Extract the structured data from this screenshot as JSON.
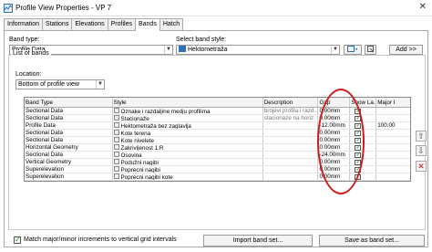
{
  "window": {
    "title": "Profile View Properties - VP 7"
  },
  "tabs": [
    "Information",
    "Stations",
    "Elevations",
    "Profiles",
    "Bands",
    "Hatch"
  ],
  "active_tab": "Bands",
  "band_type": {
    "label": "Band type:",
    "value": "Profile Data"
  },
  "band_style": {
    "label": "Select band style:",
    "value": "Hektometraža"
  },
  "buttons": {
    "add": "Add >>",
    "import": "Import band set...",
    "save": "Save as band set..."
  },
  "list_of_bands": {
    "title": "List of bands",
    "location_label": "Location:",
    "location_value": "Bottom of profile view",
    "columns": [
      "Band Type",
      "Style",
      "Description",
      "Gap",
      "Show La...",
      "Major I"
    ],
    "rows": [
      {
        "type": "Sectional Data",
        "style": "Oznake i razdaljine medju profilima",
        "desc": "brojevi profila i razd...",
        "gap": "0.00mm",
        "show": true,
        "major": ""
      },
      {
        "type": "Sectional Data",
        "style": "Stacionaže",
        "desc": "stacionaze na horiz",
        "gap": "0.00mm",
        "show": true,
        "major": ""
      },
      {
        "type": "Profile Data",
        "style": "Hektometraža bez zaglavlja",
        "desc": "",
        "gap": "-12.00mm",
        "show": true,
        "major": "100.00"
      },
      {
        "type": "Sectional Data",
        "style": "Kote terena",
        "desc": "",
        "gap": "0.00mm",
        "show": true,
        "major": ""
      },
      {
        "type": "Sectional Data",
        "style": "Kote nivelete",
        "desc": "",
        "gap": "0.00mm",
        "show": true,
        "major": ""
      },
      {
        "type": "Horizontal Geometry",
        "style": "Zakrivljenost 1:R",
        "desc": "",
        "gap": "0.00mm",
        "show": true,
        "major": ""
      },
      {
        "type": "Sectional Data",
        "style": "Osovina",
        "desc": "",
        "gap": "-24.00mm",
        "show": true,
        "major": ""
      },
      {
        "type": "Vertical Geometry",
        "style": "Podužni nagibi",
        "desc": "",
        "gap": "0.00mm",
        "show": true,
        "major": ""
      },
      {
        "type": "Superelevation",
        "style": "Poprecni nagibi",
        "desc": "",
        "gap": "0.00mm",
        "show": true,
        "major": ""
      },
      {
        "type": "Superelevation",
        "style": "Poprecni nagibi kote",
        "desc": "",
        "gap": "0.00mm",
        "show": true,
        "major": ""
      }
    ]
  },
  "match_checkbox": {
    "label": "Match major/minor increments to vertical grid intervals",
    "checked": true
  },
  "colors": {
    "annotation_ellipse": "#cc1c1c",
    "style_swatch": "#2f6fb5",
    "check": "#1a8a1a",
    "delete": "#cc1111"
  },
  "icons": {
    "app": "profile-view-icon",
    "close": "close-icon",
    "up": "arrow-up-icon",
    "down": "arrow-down-icon",
    "delete": "delete-x-icon"
  }
}
